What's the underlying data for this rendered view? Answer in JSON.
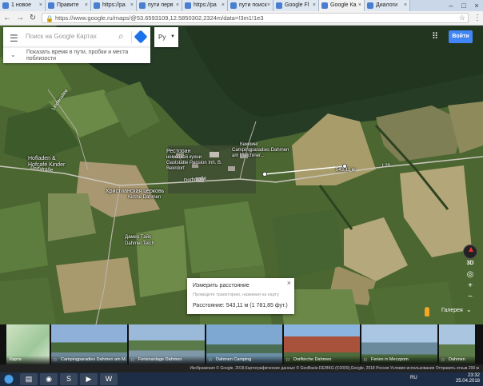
{
  "browser": {
    "tabs": [
      {
        "label": "1 новое"
      },
      {
        "label": "Правите"
      },
      {
        "label": "https://ра"
      },
      {
        "label": "пути перв"
      },
      {
        "label": "https://ра"
      },
      {
        "label": "пути поиск"
      },
      {
        "label": "Google Fl"
      },
      {
        "label": "Google Ка",
        "active": true
      },
      {
        "label": "Диалоги"
      }
    ],
    "url": "https://www.google.ru/maps/@53.6593109,12.5850302,2324m/data=!3m1!1e3",
    "back_icon": "back-arrow-icon",
    "reload_icon": "reload-icon"
  },
  "search": {
    "placeholder": "Поиск на Google Картах",
    "travel_text": "Показать время в пути, пробки и места поблизости"
  },
  "language": "Ру",
  "signin_label": "Войти",
  "map_labels": {
    "restaurant": "Ресторан",
    "restaurant_sub": "немецкой кухни",
    "restaurant_name": "Gaststätte Pension Inh. B. Bekrdorf",
    "camping": "Кемпинг",
    "camping_name": "Campingparadies Dahmen am Malchiner...",
    "hofladen": "Hofladen &",
    "hofladen2": "Hofcafé Kinder",
    "church": "Христианская церковь",
    "church_name": "Kirche Dahmen",
    "teich": "Дамер Тайх",
    "teich_name": "Dahmer Teich",
    "road_dorf": "Dorfstraße",
    "road_l20": "L20",
    "road_k": "Lindenallee",
    "road_dsb": "Dorfstraße"
  },
  "measure": {
    "title": "Измерить расстояние",
    "hint": "Проведите траекторию, нажимая на карту",
    "result": "Расстояние: 543,11 м (1 781,85 фут.)",
    "point_label": "543,11 м"
  },
  "controls": {
    "btn3d": "3D",
    "gallery": "Галерея"
  },
  "strip": {
    "items": [
      {
        "caption": "Карта"
      },
      {
        "caption": "Campingparadies Dahmen am M..."
      },
      {
        "caption": "Ferienanlage Dahmen"
      },
      {
        "caption": "Dahmen Camping"
      },
      {
        "caption": "Dorfkirche Dahmen"
      },
      {
        "caption": "Ferien in Meczpom"
      },
      {
        "caption": "Dahmen"
      }
    ]
  },
  "footer": {
    "text": "Изображения © Google, 2018,Картографические данные © GeoBasis-DE/BKG (©2009),Google, 2018   Россия   Условия использования   Отправить отзыв   200 м"
  },
  "taskbar": {
    "lang": "RU",
    "time": "23:32",
    "date": "25.04.2018"
  },
  "colors": {
    "water": "#2b3f2a",
    "field_green": "#4f6b34",
    "field_tan": "#a79c6d",
    "accent_blue": "#4285f4"
  }
}
